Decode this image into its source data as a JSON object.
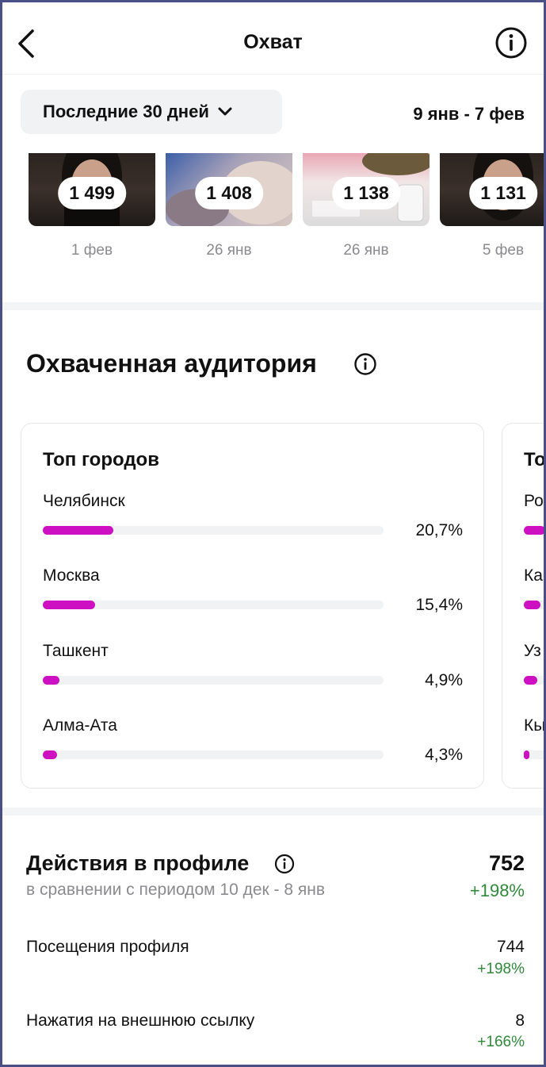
{
  "header": {
    "title": "Охват"
  },
  "filter": {
    "period_label": "Последние 30 дней",
    "date_range": "9 янв - 7 фев"
  },
  "posts": [
    {
      "count": "1 499",
      "date": "1 фев"
    },
    {
      "count": "1 408",
      "date": "26 янв"
    },
    {
      "count": "1 138",
      "date": "26 янв"
    },
    {
      "count": "1 131",
      "date": "5 фев"
    }
  ],
  "audience": {
    "title": "Охваченная аудитория",
    "top_cities": {
      "title": "Топ городов",
      "items": [
        {
          "name": "Челябинск",
          "percent": "20,7%",
          "fraction": 0.207
        },
        {
          "name": "Москва",
          "percent": "15,4%",
          "fraction": 0.154
        },
        {
          "name": "Ташкент",
          "percent": "4,9%",
          "fraction": 0.049
        },
        {
          "name": "Алма-Ата",
          "percent": "4,3%",
          "fraction": 0.043
        }
      ]
    },
    "next_card": {
      "title": "То",
      "labels": [
        "Ро",
        "Ка",
        "Уз",
        "Кы"
      ],
      "fractions": [
        0.19,
        0.15,
        0.12,
        0.05
      ]
    }
  },
  "profile_actions": {
    "title": "Действия в профиле",
    "total": "752",
    "change": "+198%",
    "comparison": "в сравнении с периодом 10 дек - 8 янв",
    "rows": [
      {
        "label": "Посещения профиля",
        "value": "744",
        "delta": "+198%"
      },
      {
        "label": "Нажатия на внешнюю ссылку",
        "value": "8",
        "delta": "+166%"
      }
    ]
  },
  "colors": {
    "accent": "#cc10c2",
    "positive": "#2f8a3a",
    "muted": "#8a8a8f"
  }
}
